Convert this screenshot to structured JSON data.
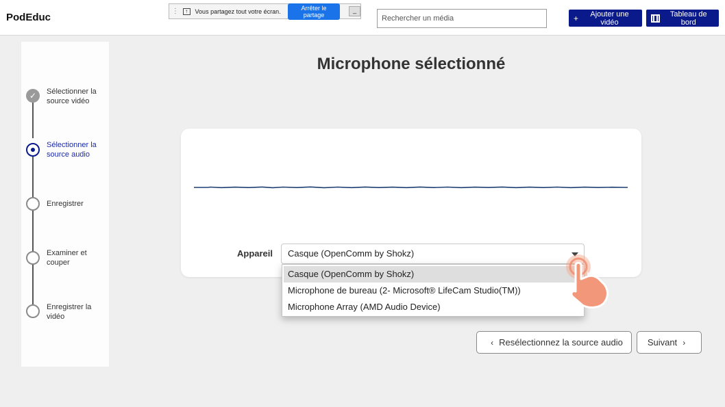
{
  "header": {
    "logo": "PodEduc",
    "share_bar": {
      "text": "Vous partagez tout votre écran.",
      "stop_label": "Arrêter le partage",
      "hide_label": "_"
    },
    "search": {
      "placeholder": "Rechercher un média"
    },
    "add_video_label": "Ajouter une vidéo",
    "dashboard_label": "Tableau de bord"
  },
  "stepper": {
    "steps": [
      {
        "label": "Sélectionner la source vidéo",
        "state": "done"
      },
      {
        "label": "Sélectionner la source audio",
        "state": "active"
      },
      {
        "label": "Enregistrer",
        "state": "pending"
      },
      {
        "label": "Examiner et couper",
        "state": "pending"
      },
      {
        "label": "Enregistrer la vidéo",
        "state": "pending"
      }
    ]
  },
  "main": {
    "title": "Microphone sélectionné",
    "device_label": "Appareil",
    "selected_device": "Casque (OpenComm by Shokz)",
    "options": [
      "Casque (OpenComm by Shokz)",
      "Microphone de bureau (2- Microsoft® LifeCam Studio(TM))",
      "Microphone Array (AMD Audio Device)"
    ],
    "back_label": "Resélectionnez la source audio",
    "next_label": "Suivant"
  },
  "colors": {
    "primary": "#0a1a8a",
    "active_step": "#1b2aa8",
    "waveform": "#1f3f73",
    "touch_pointer": "#f08a6a"
  }
}
